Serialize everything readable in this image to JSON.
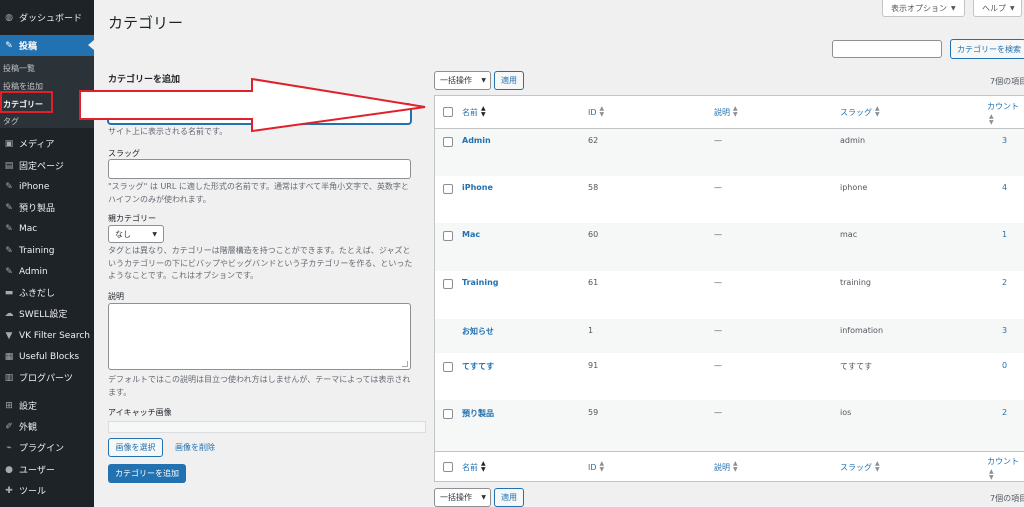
{
  "sidebar": {
    "dashboard": "ダッシュボード",
    "posts": "投稿",
    "submenu": {
      "all_posts": "投稿一覧",
      "add_new": "投稿を追加",
      "categories": "カテゴリー",
      "tags": "タグ"
    },
    "items": [
      {
        "label": "メディア",
        "icon": "media-icon"
      },
      {
        "label": "固定ページ",
        "icon": "page-icon"
      },
      {
        "label": "iPhone",
        "icon": "pin-icon"
      },
      {
        "label": "預り製品",
        "icon": "pin-icon"
      },
      {
        "label": "Mac",
        "icon": "pin-icon"
      },
      {
        "label": "Training",
        "icon": "pin-icon"
      },
      {
        "label": "Admin",
        "icon": "pin-icon"
      },
      {
        "label": "ふきだし",
        "icon": "balloon-icon"
      },
      {
        "label": "SWELL設定",
        "icon": "cloud-icon"
      },
      {
        "label": "VK Filter Search",
        "icon": "vk-icon"
      },
      {
        "label": "Useful Blocks",
        "icon": "grid-icon"
      },
      {
        "label": "ブログパーツ",
        "icon": "blog-parts-icon"
      },
      {
        "label": "設定",
        "icon": "settings-icon"
      },
      {
        "label": "外観",
        "icon": "brush-icon"
      },
      {
        "label": "プラグイン",
        "icon": "plugin-icon"
      },
      {
        "label": "ユーザー",
        "icon": "user-icon"
      },
      {
        "label": "ツール",
        "icon": "wrench-icon"
      }
    ]
  },
  "header": {
    "title": "カテゴリー",
    "screen_options": "表示オプション",
    "help": "ヘルプ"
  },
  "search": {
    "placeholder": "",
    "button": "カテゴリーを検索"
  },
  "form": {
    "heading": "カテゴリーを追加",
    "name_help": "サイト上に表示される名前です。",
    "slug_label": "スラッグ",
    "slug_help": "\"スラッグ\" は URL に適した形式の名前です。通常はすべて半角小文字で、英数字とハイフンのみが使われます。",
    "parent_label": "親カテゴリー",
    "parent_value": "なし",
    "parent_help": "タグとは異なり、カテゴリーは階層構造を持つことができます。たとえば、ジャズというカテゴリーの下にビバップやビッグバンドという子カテゴリーを作る、といったようなことです。これはオプションです。",
    "description_label": "説明",
    "description_help": "デフォルトではこの説明は目立つ使われ方はしませんが、テーマによっては表示されます。",
    "eyecatch_label": "アイキャッチ画像",
    "select_image": "画像を選択",
    "remove_image": "画像を削除",
    "submit": "カテゴリーを追加"
  },
  "bulk": {
    "action": "一括操作",
    "apply": "適用",
    "count": "7個の項目"
  },
  "table": {
    "columns": {
      "name": "名前",
      "id": "ID",
      "description": "説明",
      "slug": "スラッグ",
      "count": "カウント"
    },
    "rows": [
      {
        "name": "Admin",
        "id": "62",
        "description": "—",
        "slug": "admin",
        "count": "3",
        "checkbox": true
      },
      {
        "name": "iPhone",
        "id": "58",
        "description": "—",
        "slug": "iphone",
        "count": "4",
        "checkbox": true
      },
      {
        "name": "Mac",
        "id": "60",
        "description": "—",
        "slug": "mac",
        "count": "1",
        "checkbox": true
      },
      {
        "name": "Training",
        "id": "61",
        "description": "—",
        "slug": "training",
        "count": "2",
        "checkbox": true
      },
      {
        "name": "お知らせ",
        "id": "1",
        "description": "—",
        "slug": "infomation",
        "count": "3",
        "checkbox": false
      },
      {
        "name": "てすてす",
        "id": "91",
        "description": "—",
        "slug": "てすてす",
        "count": "0",
        "checkbox": true
      },
      {
        "name": "預り製品",
        "id": "59",
        "description": "—",
        "slug": "ios",
        "count": "2",
        "checkbox": true
      }
    ]
  },
  "colors": {
    "sidebar_bg": "#1d2327",
    "accent": "#2271b1",
    "annotation_red": "#e0202a"
  }
}
